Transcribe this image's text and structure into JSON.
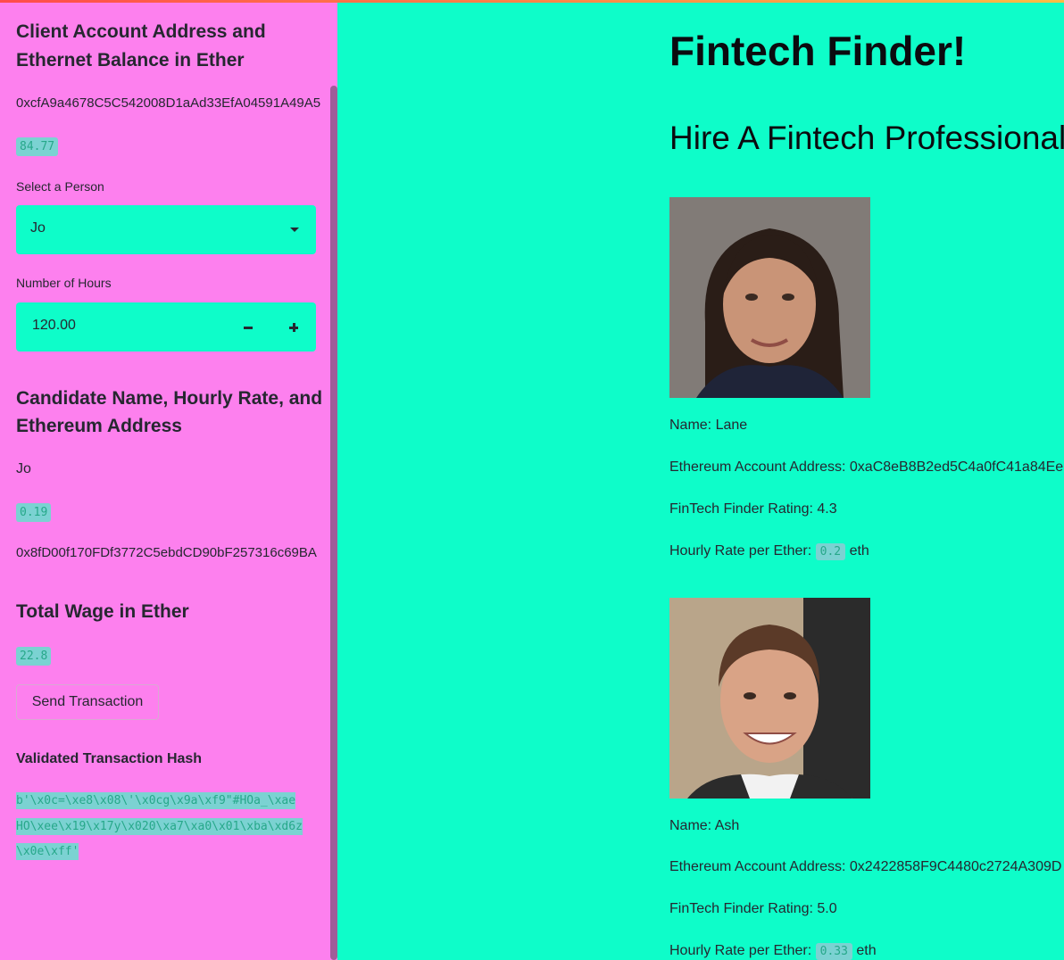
{
  "sidebar": {
    "client_heading_line1": "Client Account Address and",
    "client_heading_line2": "Ethernet Balance in Ether",
    "client_address": "0xcfA9a4678C5C542008D1aAd33EfA04591A49A5",
    "client_balance": "84.77",
    "select_person_label": "Select a Person",
    "selected_person": "Jo",
    "hours_label": "Number of Hours",
    "hours_value": "120.00",
    "candidate_heading_line1": "Candidate Name, Hourly Rate, and",
    "candidate_heading_line2": "Ethereum Address",
    "candidate_name": "Jo",
    "candidate_rate": "0.19",
    "candidate_address": "0x8fD00f170FDf3772C5ebdCD90bF257316c69BA",
    "wage_heading": "Total Wage in Ether",
    "wage_value": "22.8",
    "send_button": "Send Transaction",
    "hash_heading": "Validated Transaction Hash",
    "hash_line1": "b'\\x0c=\\xe8\\x08\\'\\x0cg\\x9a\\xf9\"#HOa_\\xae",
    "hash_line2": "HO\\xee\\x19\\x17y\\x020\\xa7\\xa0\\x01\\xba\\xd6z",
    "hash_line3": "\\x0e\\xff'"
  },
  "main": {
    "title": "Fintech Finder!",
    "subtitle": "Hire A Fintech Professional",
    "candidates": [
      {
        "name_line": "Name: Lane",
        "address_line": "Ethereum Account Address: 0xaC8eB8B2ed5C4a0fC41a84Ee",
        "rating_line": "FinTech Finder Rating: 4.3",
        "rate_prefix": "Hourly Rate per Ether:",
        "rate_value": "0.2",
        "rate_suffix": "eth"
      },
      {
        "name_line": "Name: Ash",
        "address_line": "Ethereum Account Address: 0x2422858F9C4480c2724A309D",
        "rating_line": "FinTech Finder Rating: 5.0",
        "rate_prefix": "Hourly Rate per Ether:",
        "rate_value": "0.33",
        "rate_suffix": "eth"
      }
    ]
  },
  "colors": {
    "sidebar_bg": "#fd80ee",
    "main_bg": "#0efdc9",
    "code_bg": "#7bd2d2",
    "code_text": "#27a88a"
  }
}
